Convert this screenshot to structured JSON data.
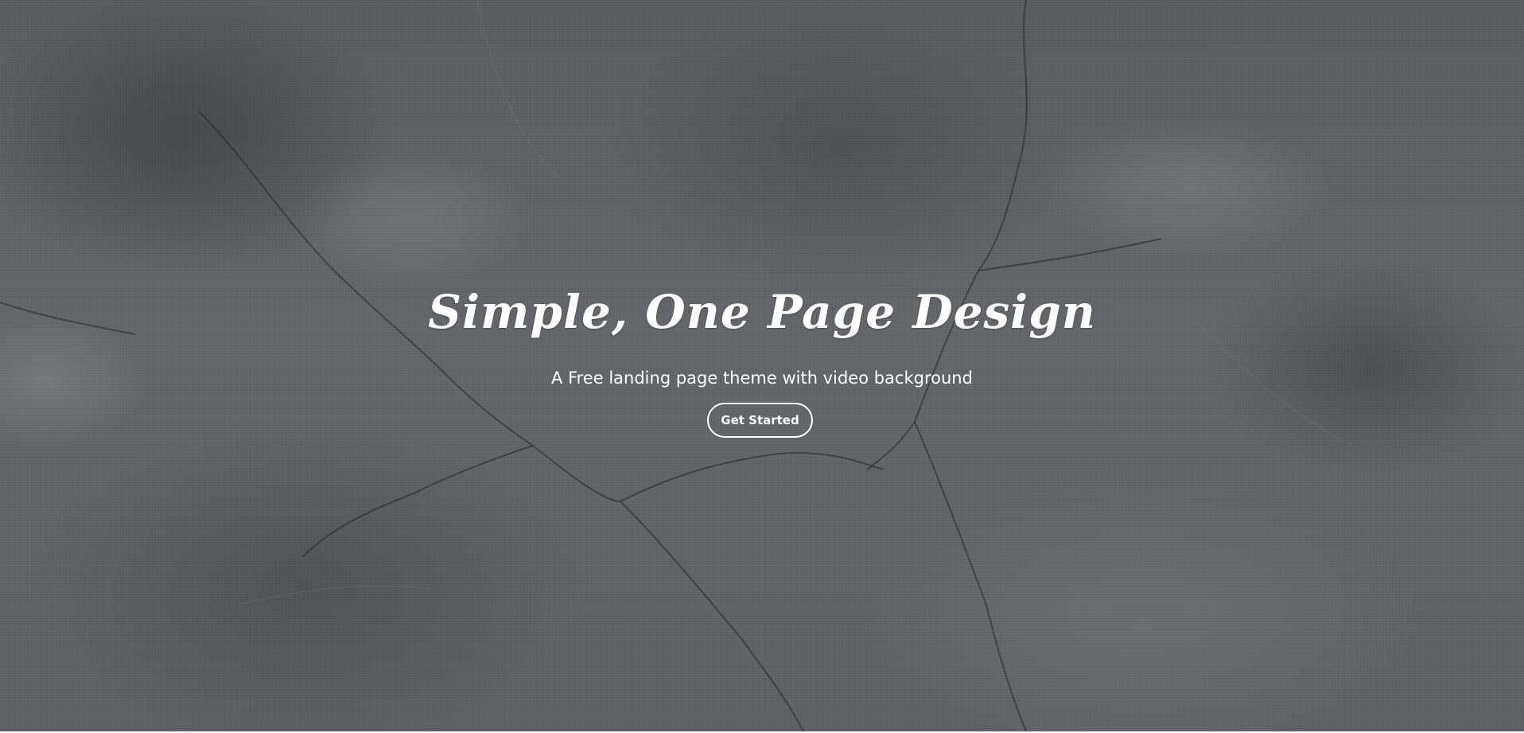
{
  "hero": {
    "title": "Simple, One Page Design",
    "subtitle": "A Free landing page theme with video background",
    "cta_label": "Get Started",
    "background": "stone-texture-video-background"
  },
  "colors": {
    "text": "#ffffff",
    "background": "#5c6064",
    "button_border": "#ffffff"
  }
}
